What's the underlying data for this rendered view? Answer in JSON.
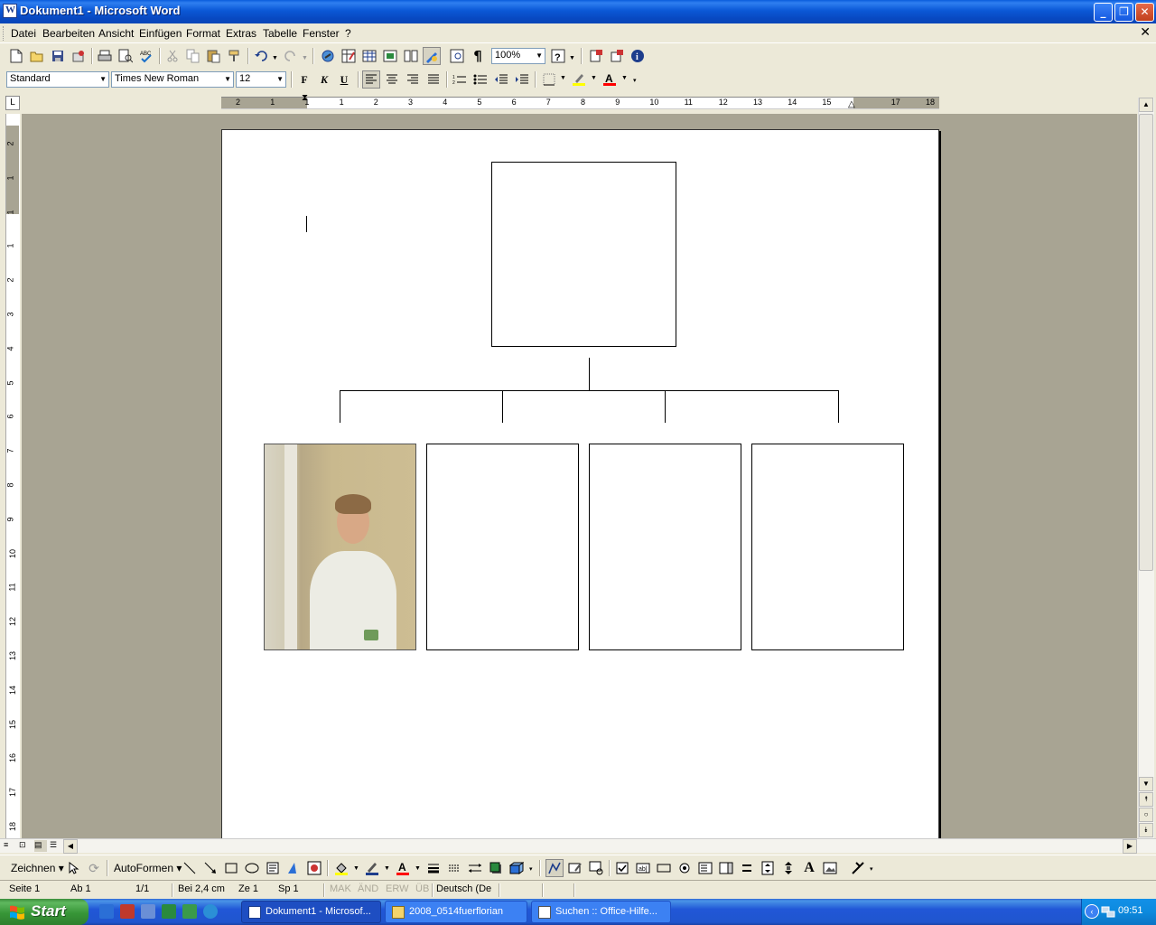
{
  "window": {
    "title": "Dokument1 - Microsoft Word"
  },
  "menu": {
    "items": [
      {
        "label": "Datei"
      },
      {
        "label": "Bearbeiten"
      },
      {
        "label": "Ansicht"
      },
      {
        "label": "Einfügen"
      },
      {
        "label": "Format"
      },
      {
        "label": "Extras"
      },
      {
        "label": "Tabelle"
      },
      {
        "label": "Fenster"
      },
      {
        "label": "?"
      }
    ]
  },
  "standard_toolbar": {
    "zoom": "100%"
  },
  "format_toolbar": {
    "style": "Standard",
    "font": "Times New Roman",
    "size": "12",
    "bold_label": "F",
    "italic_label": "K",
    "underline_label": "U"
  },
  "ruler": {
    "top_numbers": [
      "2",
      "1",
      "1",
      "1",
      "2",
      "3",
      "4",
      "5",
      "6",
      "7",
      "8",
      "9",
      "10",
      "11",
      "12",
      "13",
      "14",
      "15",
      "17",
      "18"
    ],
    "left_numbers": [
      "2",
      "1",
      "1",
      "1",
      "2",
      "3",
      "4",
      "5",
      "6",
      "7",
      "8",
      "9",
      "10",
      "11",
      "12",
      "13",
      "14",
      "15",
      "16",
      "17",
      "18"
    ]
  },
  "drawing_toolbar": {
    "draw_label": "Zeichnen",
    "autoshapes_label": "AutoFormen"
  },
  "status": {
    "page": "Seite  1",
    "section": "Ab  1",
    "pages": "1/1",
    "at": "Bei  2,4 cm",
    "line": "Ze  1",
    "col": "Sp  1",
    "rec": "MAK",
    "trk": "ÄND",
    "ext": "ERW",
    "ovr": "ÜB",
    "language": "Deutsch (De"
  },
  "taskbar": {
    "start_label": "Start",
    "tasks": [
      {
        "label": "Dokument1 - Microsof..."
      },
      {
        "label": "2008_0514fuerflorian"
      },
      {
        "label": "Suchen :: Office-Hilfe..."
      }
    ],
    "clock": "09:51"
  },
  "colors": {
    "titlebar": "#0a5ddc",
    "highlight": "#ffff00",
    "font_color": "#ff0000",
    "page_background": "#a8a493"
  }
}
